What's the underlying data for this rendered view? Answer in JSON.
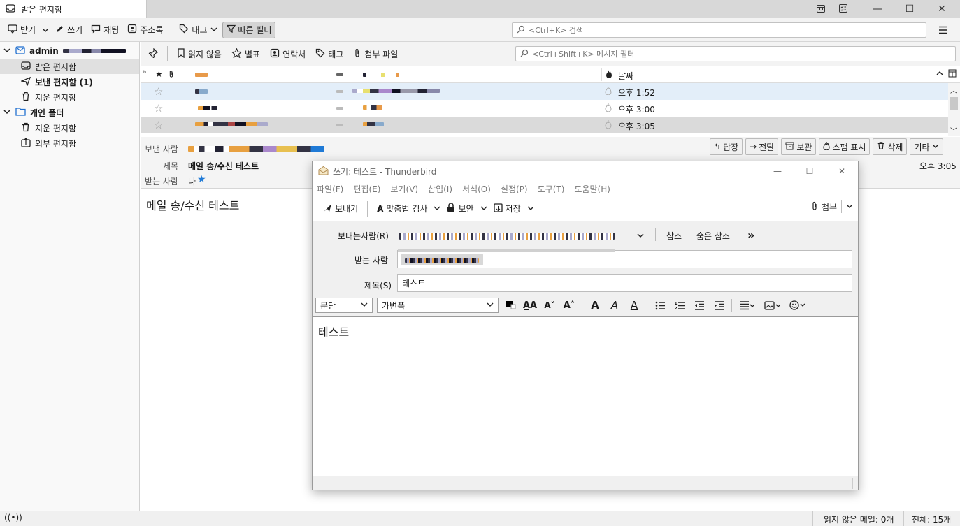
{
  "window": {
    "tab_title": "받은 편지함"
  },
  "toolbar": {
    "get_messages": "받기",
    "write": "쓰기",
    "chat": "채팅",
    "address_book": "주소록",
    "tag": "태그",
    "quick_filter": "빠른 필터",
    "search_placeholder": "<Ctrl+K> 검색"
  },
  "folders": {
    "account": "admin",
    "inbox": "받은 편지함",
    "sent": "보낸 편지함 (1)",
    "trash": "지운 편지함",
    "local_folders": "개인 폴더",
    "local_trash": "지운 편지함",
    "outbox": "외부 편지함"
  },
  "quick_filter": {
    "unread": "읽지 않음",
    "starred": "별표",
    "contact": "연락처",
    "tags": "태그",
    "attachment": "첨부 파일",
    "filter_placeholder": "<Ctrl+Shift+K> 메시지 필터"
  },
  "thread": {
    "date_header": "날짜",
    "rows": [
      {
        "date": "오후 1:52"
      },
      {
        "date": "오후 3:00"
      },
      {
        "date": "오후 3:05"
      }
    ]
  },
  "header": {
    "from_label": "보낸 사람",
    "subject_label": "제목",
    "subject": "메일 송/수신 테스트",
    "to_label": "받는 사람",
    "to_value": "나",
    "date": "오후 3:05",
    "reply": "답장",
    "forward": "전달",
    "archive": "보관",
    "junk": "스팸 표시",
    "delete": "삭제",
    "more": "기타"
  },
  "message": {
    "body": "메일 송/수신 테스트"
  },
  "status": {
    "unread": "읽지 않은 메일: 0개",
    "total": "전체: 15개"
  },
  "compose": {
    "title": "쓰기: 테스트 - Thunderbird",
    "menu": [
      "파일(F)",
      "편집(E)",
      "보기(V)",
      "삽입(I)",
      "서식(O)",
      "설정(P)",
      "도구(T)",
      "도움말(H)"
    ],
    "send": "보내기",
    "spell": "맞춤법 검사",
    "security": "보안",
    "save": "저장",
    "attach": "첨부",
    "from_label": "보내는사람(R)",
    "cc": "참조",
    "bcc": "숨은 참조",
    "to_label": "받는 사람",
    "subject_label": "제목(S)",
    "subject": "테스트",
    "paragraph": "문단",
    "font": "가변폭",
    "body": "테스트"
  },
  "colors": {
    "accent": "#0a84ff",
    "selected_row": "#e3eef9",
    "star": "#1f7ad6"
  }
}
